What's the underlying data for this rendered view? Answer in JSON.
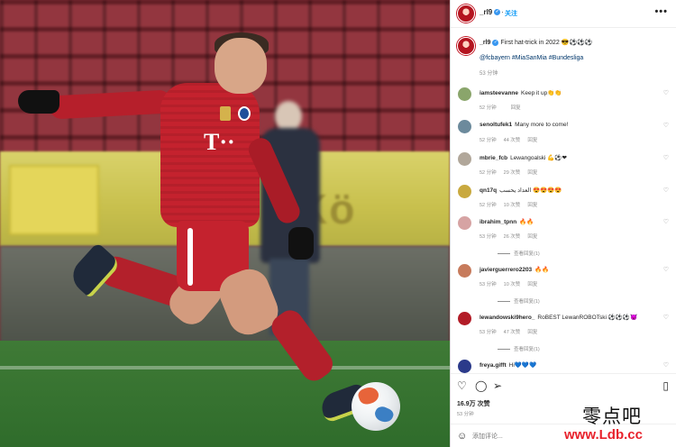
{
  "post": {
    "username": "_rl9",
    "follow_label": "关注",
    "more_label": "•••",
    "caption_text": "First hat-trick in 2022 😎⚽⚽⚽",
    "caption_tags": "@fcbayern #MiaSanMia #Bundesliga",
    "caption_time": "53 分钟"
  },
  "comments": [
    {
      "user": "iamsteevanne",
      "text": "Keep it up👏👏",
      "time": "52 分钟",
      "likes": "",
      "reply": "回复",
      "avatar_color": "#8aa56b",
      "replies": ""
    },
    {
      "user": "senoltufek1",
      "text": "Many more to come!",
      "time": "52 分钟",
      "likes": "44 次赞",
      "reply": "回复",
      "avatar_color": "#6c8a9c",
      "replies": ""
    },
    {
      "user": "mbrie_fcb",
      "text": "Lewangoalski 💪⚽❤",
      "time": "52 分钟",
      "likes": "29 次赞",
      "reply": "回复",
      "avatar_color": "#b1a79a",
      "replies": ""
    },
    {
      "user": "qn17q",
      "text": "العداد يحسب 😍😍😍😍",
      "time": "52 分钟",
      "likes": "10 次赞",
      "reply": "回复",
      "avatar_color": "#c9a93f",
      "replies": ""
    },
    {
      "user": "ibrahim_tpnn",
      "text": "🔥🔥",
      "time": "53 分钟",
      "likes": "26 次赞",
      "reply": "回复",
      "avatar_color": "#d6a3a3",
      "replies": "查看回复(1)"
    },
    {
      "user": "javierguerrero2203",
      "text": "🔥🔥",
      "time": "53 分钟",
      "likes": "10 次赞",
      "reply": "回复",
      "avatar_color": "#c77b5c",
      "replies": "查看回复(1)"
    },
    {
      "user": "lewandowski9hero_",
      "text": "RoBEST LewanROBOTski ⚽⚽⚽😈",
      "time": "53 分钟",
      "likes": "47 次赞",
      "reply": "回复",
      "avatar_color": "#b21c27",
      "replies": "查看回复(1)"
    },
    {
      "user": "freya.gifft",
      "text": "Hi💙💙💙",
      "time": "",
      "likes": "",
      "reply": "",
      "avatar_color": "#2b3a8a",
      "replies": ""
    }
  ],
  "actions": {
    "likes": "16.9万 次赞",
    "time": "53 分钟",
    "comment_placeholder": "添加评论..."
  },
  "watermark": {
    "site_name": "零点吧",
    "url": "www.Ldb.cc"
  },
  "icons": {
    "like": "heart-icon",
    "comment": "comment-icon",
    "share": "send-icon",
    "save": "bookmark-icon",
    "emoji": "emoji-icon"
  },
  "colors": {
    "link_blue": "#0095f6",
    "verified_blue": "#3897f0",
    "watermark_red": "#e8212b"
  }
}
